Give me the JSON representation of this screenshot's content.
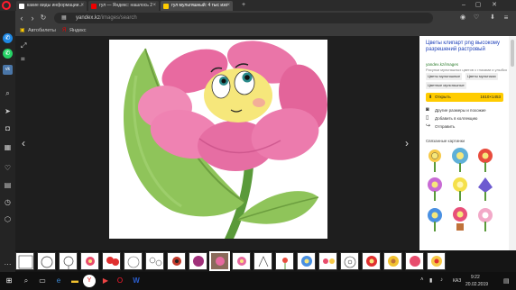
{
  "browser": {
    "tabs": [
      {
        "title": "какие виды информации...",
        "favicon": "google-favicon",
        "color": "#4285f4"
      },
      {
        "title": "гул — Яндекс: нашлось 2",
        "favicon": "yandex-favicon",
        "color": "#e00"
      },
      {
        "title": "гул мультяшный: 4 тыс изо",
        "favicon": "yandex-images-favicon",
        "color": "#fc0"
      }
    ],
    "url_host": "yandex.kz",
    "url_path": "/images/search",
    "bookmarks": [
      "Автобилеты",
      "Яндекс"
    ]
  },
  "sidebar_icons": [
    "messenger-icon",
    "whatsapp-icon",
    "vk-icon",
    "search-icon",
    "send-icon",
    "camera-icon",
    "grid-icon",
    "heart-icon",
    "news-icon",
    "clock-icon",
    "cube-icon"
  ],
  "panel": {
    "title": "Цветы клипарт png высокому разрешений растровый",
    "site": "yandex.kz/images",
    "description": "Рисунки мультяшных цветов с глазами и улыбкой...",
    "tags": [
      "Цветы мультяшные",
      "Цветы мультиках",
      "Цветные мультяшные"
    ],
    "open_label": "Открыть",
    "size": "1610×1453",
    "actions": [
      "Другие размеры и похожие",
      "Добавить в коллекцию",
      "Отправить"
    ],
    "related_title": "Связанные картинки"
  },
  "taskbar": {
    "lang": "КАЗ",
    "time": "9:22",
    "date": "20.02.2019"
  },
  "colors": {
    "accent_yellow": "#ffcc00",
    "link_blue": "#1b3eb8",
    "opera_red": "#ff1b2d"
  }
}
